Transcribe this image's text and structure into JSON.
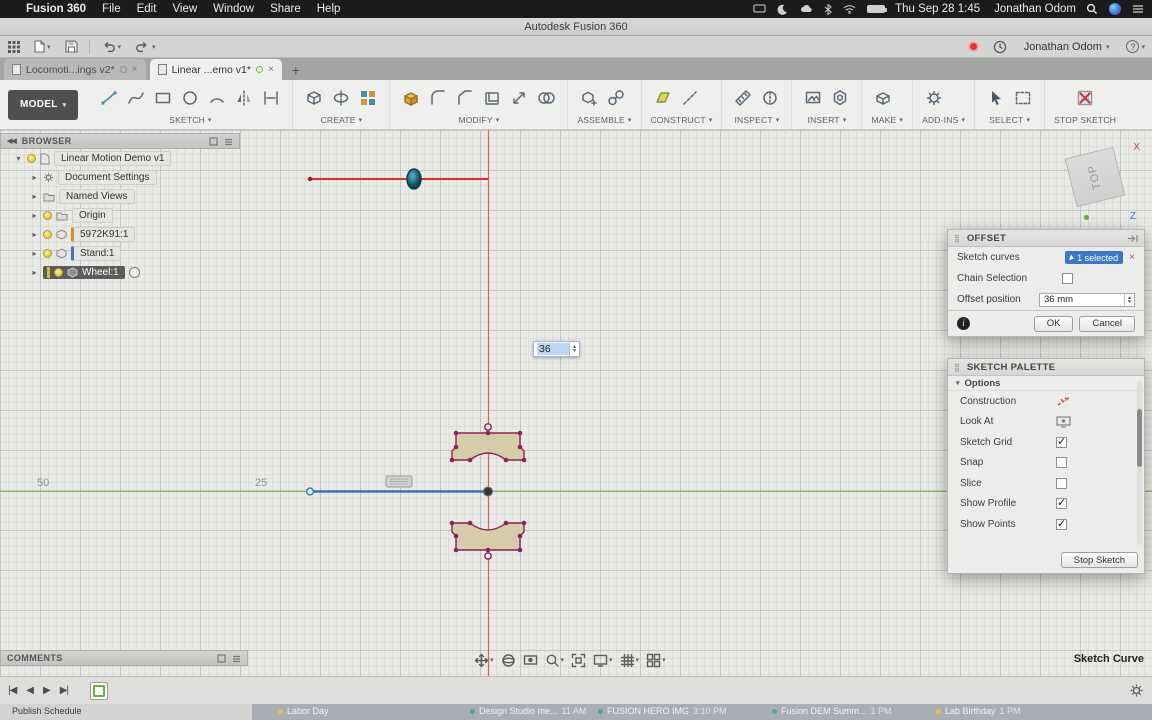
{
  "colors": {
    "accent_blue": "#3c78c8",
    "axis_green": "#7db348",
    "sketch_blue": "#3a78c2",
    "preview_red": "#e02b2b",
    "profile_stroke": "#8a2356",
    "profile_fill": "#d7cca9"
  },
  "icons": {
    "caret_down": "▾",
    "chevron_right": "▸",
    "chevron_down": "▾",
    "close": "×",
    "plus": "+",
    "collapse": "◀◀",
    "apple": "",
    "help": "?"
  },
  "menubar": {
    "app_name": "Fusion 360",
    "menus": {
      "file": "File",
      "edit": "Edit",
      "view": "View",
      "window": "Window",
      "share": "Share",
      "help": "Help"
    },
    "clock": "Thu Sep 28 1:45",
    "user": "Jonathan Odom"
  },
  "titlebar": {
    "title": "Autodesk Fusion 360"
  },
  "quickbar": {
    "user": "Jonathan Odom"
  },
  "tabs": {
    "tab1": "Locomoti...ings v2*",
    "tab2": "Linear ...emo v1*"
  },
  "ribbon": {
    "workspace": "MODEL",
    "sketch": "SKETCH",
    "create": "CREATE",
    "modify": "MODIFY",
    "assemble": "ASSEMBLE",
    "construct": "CONSTRUCT",
    "inspect": "INSPECT",
    "insert": "INSERT",
    "make": "MAKE",
    "addins": "ADD-INS",
    "select": "SELECT",
    "stop_sketch": "STOP SKETCH"
  },
  "browser": {
    "title": "BROWSER",
    "root": "Linear Motion Demo v1",
    "items": [
      {
        "label": "Document Settings"
      },
      {
        "label": "Named Views"
      },
      {
        "label": "Origin"
      },
      {
        "label": "5972K91:1"
      },
      {
        "label": "Stand:1"
      },
      {
        "label": "Wheel:1"
      }
    ]
  },
  "viewcube": {
    "face": "TOP",
    "axis_x": "X",
    "axis_z": "Z"
  },
  "canvas": {
    "offset_value": "36",
    "ruler_50": "50",
    "ruler_25": "25"
  },
  "offset_dialog": {
    "title": "OFFSET",
    "sketch_curves_label": "Sketch curves",
    "selected_badge": "1 selected",
    "chain_selection_label": "Chain Selection",
    "chain_selection_checked": false,
    "offset_position_label": "Offset position",
    "offset_position_value": "36 mm",
    "ok": "OK",
    "cancel": "Cancel"
  },
  "sketch_palette": {
    "title": "SKETCH PALETTE",
    "options_header": "Options",
    "items": [
      {
        "label": "Construction",
        "control": "construction-icon"
      },
      {
        "label": "Look At",
        "control": "lookat-icon"
      },
      {
        "label": "Sketch Grid",
        "checked": true
      },
      {
        "label": "Snap",
        "checked": false
      },
      {
        "label": "Slice",
        "checked": false
      },
      {
        "label": "Show Profile",
        "checked": true
      },
      {
        "label": "Show Points",
        "checked": true
      }
    ],
    "stop_sketch": "Stop Sketch"
  },
  "comments": {
    "title": "COMMENTS"
  },
  "status": {
    "mode": "Sketch Curve"
  },
  "timeline": {
    "controls": [
      "|◀",
      "◀",
      "▶",
      "▶|"
    ]
  },
  "bottom_strip": {
    "items": [
      {
        "label": "Publish Schedule",
        "time": ""
      },
      {
        "label": "Labor Day",
        "time": ""
      },
      {
        "label": "Design Studio me...",
        "time": "11 AM"
      },
      {
        "label": "FUSION HERO IMG",
        "time": "3:10 PM"
      },
      {
        "label": "Fusion DEM Summ...",
        "time": "1 PM"
      },
      {
        "label": "Lab Birthday",
        "time": "1 PM"
      }
    ]
  }
}
